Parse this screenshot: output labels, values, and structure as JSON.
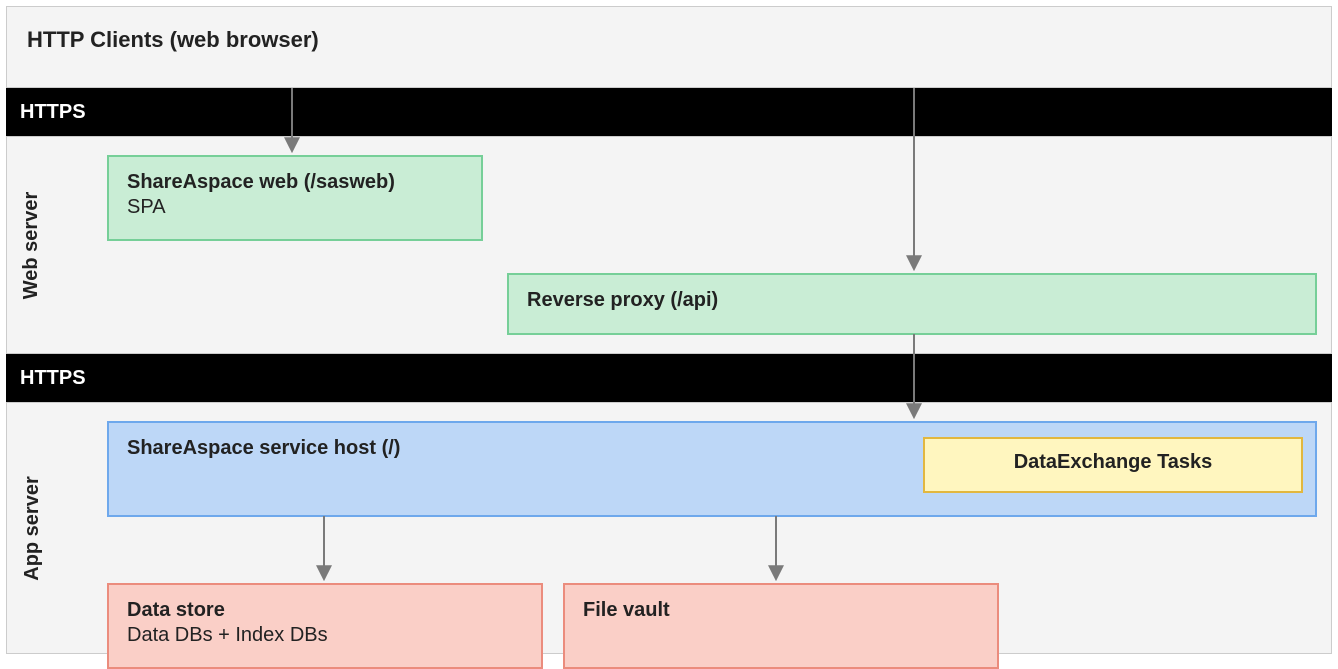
{
  "clients": {
    "title": "HTTP Clients (web browser)"
  },
  "bands": {
    "https1": "HTTPS",
    "https2": "HTTPS"
  },
  "web_server": {
    "label": "Web server",
    "sasweb": {
      "title": "ShareAspace web (/sasweb)",
      "sub": "SPA"
    },
    "reverse_proxy": {
      "title": "Reverse proxy (/api)"
    }
  },
  "app_server": {
    "label": "App server",
    "service_host": {
      "title": "ShareAspace service host (/)"
    },
    "data_exchange": {
      "title": "DataExchange Tasks"
    },
    "data_store": {
      "title": "Data store",
      "sub": "Data DBs + Index DBs"
    },
    "file_vault": {
      "title": "File vault"
    }
  },
  "colors": {
    "panel_bg": "#f4f4f4",
    "green_fill": "#c9edd5",
    "green_border": "#76cf98",
    "blue_fill": "#bdd7f7",
    "blue_border": "#6ea8ec",
    "yellow_fill": "#fff6bf",
    "yellow_border": "#e2b73f",
    "red_fill": "#facfc7",
    "red_border": "#eb8c7d",
    "arrow": "#7a7a7a"
  }
}
